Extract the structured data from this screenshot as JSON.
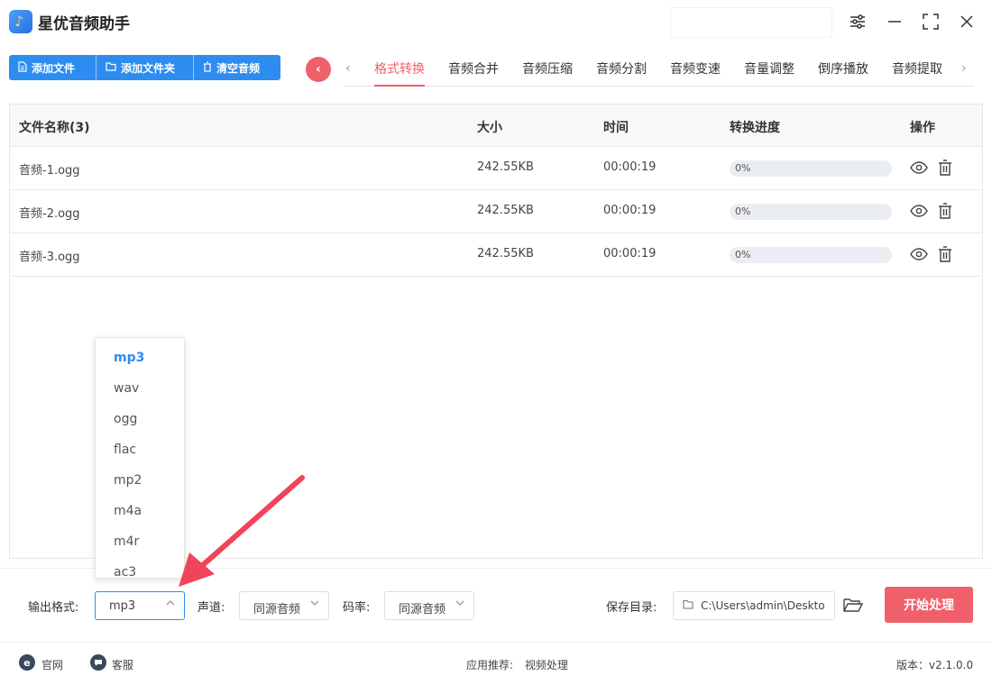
{
  "app": {
    "title": "星优音频助手"
  },
  "toolbar": {
    "add_file": "添加文件",
    "add_folder": "添加文件夹",
    "clear_audio": "清空音频"
  },
  "tabs": [
    "格式转换",
    "音频合并",
    "音频压缩",
    "音频分割",
    "音频变速",
    "音量调整",
    "倒序播放",
    "音频提取"
  ],
  "active_tab": "格式转换",
  "table": {
    "headers": {
      "name": "文件名称(3)",
      "size": "大小",
      "time": "时间",
      "progress": "转换进度",
      "ops": "操作"
    },
    "rows": [
      {
        "name": "音频-1.ogg",
        "size": "242.55KB",
        "time": "00:00:19",
        "progress_text": "0%",
        "progress": 0
      },
      {
        "name": "音频-2.ogg",
        "size": "242.55KB",
        "time": "00:00:19",
        "progress_text": "0%",
        "progress": 0
      },
      {
        "name": "音频-3.ogg",
        "size": "242.55KB",
        "time": "00:00:19",
        "progress_text": "0%",
        "progress": 0
      }
    ]
  },
  "format_dropdown": {
    "options": [
      "mp3",
      "wav",
      "ogg",
      "flac",
      "mp2",
      "m4a",
      "m4r",
      "ac3"
    ],
    "selected": "mp3"
  },
  "output": {
    "format_label": "输出格式:",
    "format_value": "mp3",
    "channel_label": "声道:",
    "channel_value": "同源音频",
    "bitrate_label": "码率:",
    "bitrate_value": "同源音频",
    "save_dir_label": "保存目录:",
    "save_dir_value": "C:\\Users\\admin\\Deskto",
    "start_button": "开始处理"
  },
  "footer": {
    "website": "官网",
    "support": "客服",
    "recommend_label": "应用推荐:",
    "recommend_value": "视频处理",
    "version": "版本：v2.1.0.0"
  },
  "colors": {
    "accent_blue": "#2d8cf0",
    "accent_red": "#f0606a"
  }
}
